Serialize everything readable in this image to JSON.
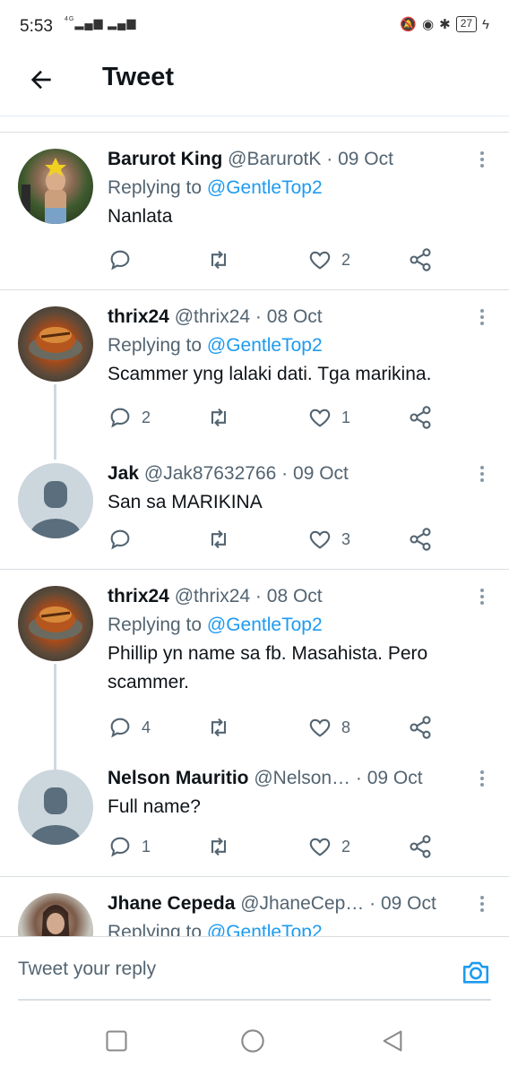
{
  "status_bar": {
    "time": "5:53",
    "network": "4G",
    "battery": "27"
  },
  "header": {
    "title": "Tweet"
  },
  "tweets": [
    {
      "name": "Barurot King",
      "handle": "@BarurotK",
      "date": "09 Oct",
      "replying_label": "Replying to",
      "replying_to": "@GentleTop2",
      "text": "Nanlata",
      "replies": "",
      "likes": "2"
    },
    {
      "name": "thrix24",
      "handle": "@thrix24",
      "date": "08 Oct",
      "replying_label": "Replying to",
      "replying_to": "@GentleTop2",
      "text": "Scammer yng lalaki dati. Tga marikina.",
      "replies": "2",
      "likes": "1"
    },
    {
      "name": "Jak",
      "handle": "@Jak87632766",
      "date": "09 Oct",
      "text": "San sa MARIKINA",
      "replies": "",
      "likes": "3"
    },
    {
      "name": "thrix24",
      "handle": "@thrix24",
      "date": "08 Oct",
      "replying_label": "Replying to",
      "replying_to": "@GentleTop2",
      "text": "Phillip yn name sa fb. Masahista. Pero scammer.",
      "replies": "4",
      "likes": "8"
    },
    {
      "name": "Nelson Mauritio",
      "handle": "@Nelson…",
      "date": "09 Oct",
      "text": "Full name?",
      "replies": "1",
      "likes": "2"
    },
    {
      "name": "Jhane Cepeda",
      "handle": "@JhaneCep…",
      "date": "09 Oct",
      "replying_label": "Replying to",
      "replying_to": "@GentleTop2"
    }
  ],
  "reply_bar": {
    "placeholder": "Tweet your reply"
  },
  "colors": {
    "accent": "#1d9bf0",
    "muted": "#536471",
    "text": "#0f1419"
  }
}
